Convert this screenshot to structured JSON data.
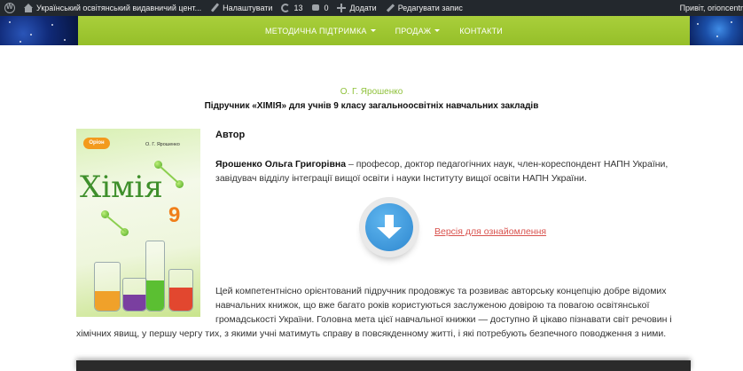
{
  "adminbar": {
    "site_name": "Український освітянський видавничий цент...",
    "customize": "Налаштувати",
    "updates_count": "13",
    "comments_count": "0",
    "add_new": "Додати",
    "edit_post": "Редагувати запис",
    "greeting": "Привіт, orioncentr"
  },
  "nav": {
    "items": [
      {
        "label": "МЕТОДИЧНА ПІДТРИМКА"
      },
      {
        "label": "ПРОДАЖ"
      },
      {
        "label": "КОНТАКТИ"
      }
    ]
  },
  "page": {
    "author_top": "О. Г. Ярошенко",
    "title": "Підручник «ХІМІЯ» для учнів 9 класу загальноосвітніх навчальних закладів",
    "author_label": "Автор",
    "author_name": "Ярошенко Ольга Григорівна",
    "author_bio": " – професор, доктор педагогічних наук, член-кореспондент НАПН України, завідувач відділу інтеграції вищої освіти і науки Інституту вищої освіти НАПН України.",
    "preview_link": "Версія для ознайомлення",
    "description_part1": "Цей компетентнісно орієнтований підручник продовжує та розвиває авторську концепцію добре відомих навчальних книжок, що вже багато років користуються заслуженою довірою та повагою освітянської громадськості України. Головна мета цієї навчальної книжки — доступно й цікаво пізнавати світ речовин і",
    "description_part2": "хімічних явищ, у першу чергу тих, з якими учні матимуть справу в повсякденному житті, і які потребують безпечного поводження з ними."
  },
  "cover": {
    "publisher": "Оріон",
    "author": "О. Г. Ярошенко",
    "title": "Хімія",
    "grade": "9"
  },
  "colors": {
    "accent_green": "#9bc42f",
    "link_red": "#d9534f",
    "adminbar": "#23282d"
  }
}
